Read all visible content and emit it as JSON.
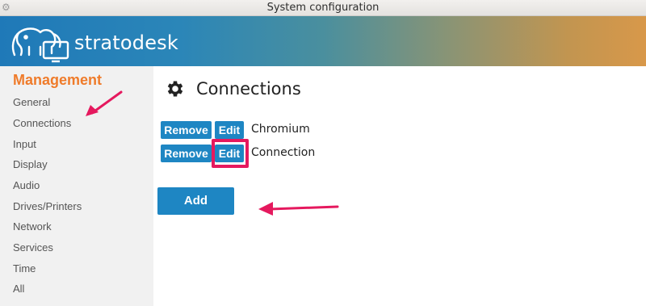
{
  "window": {
    "title": "System configuration",
    "title_icon": "gear-icon"
  },
  "brand": {
    "name": "stratodesk",
    "logo_icon": "elephant-monitor-logo"
  },
  "sidebar": {
    "heading": "Management",
    "items": [
      {
        "label": "General"
      },
      {
        "label": "Connections"
      },
      {
        "label": "Input"
      },
      {
        "label": "Display"
      },
      {
        "label": "Audio"
      },
      {
        "label": "Drives/Printers"
      },
      {
        "label": "Network"
      },
      {
        "label": "Services"
      },
      {
        "label": "Time"
      },
      {
        "label": "All"
      }
    ]
  },
  "main": {
    "title": "Connections",
    "title_icon": "gear-icon",
    "connections": [
      {
        "remove_label": "Remove",
        "edit_label": "Edit",
        "name": "Chromium"
      },
      {
        "remove_label": "Remove",
        "edit_label": "Edit",
        "name": "Connection"
      }
    ],
    "add_label": "Add"
  },
  "colors": {
    "accent": "#1e86c3",
    "heading": "#ef7b2a",
    "annotation": "#e5195e"
  }
}
